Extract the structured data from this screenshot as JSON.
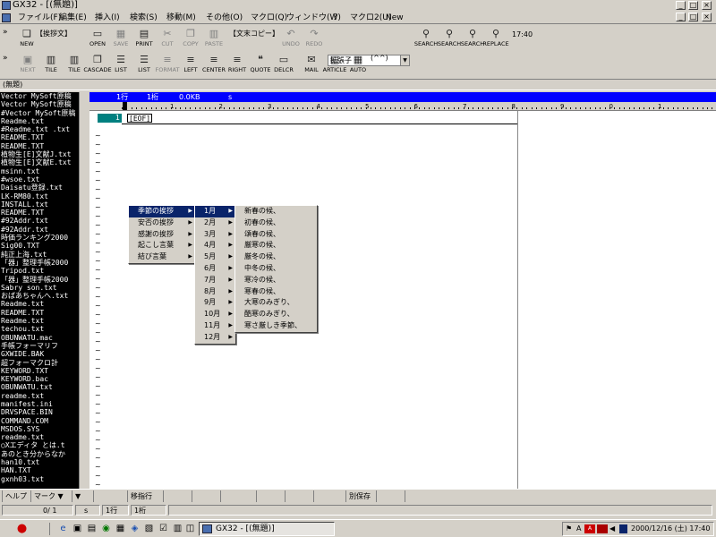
{
  "window": {
    "title": "GX32 - [(無題)]"
  },
  "menu": [
    "ファイル(F)",
    "編集(E)",
    "挿入(I)",
    "検索(S)",
    "移動(M)",
    "その他(O)",
    "マクロ(Q)",
    "ウィンドウ(W)",
    "？",
    "マクロ2(U)",
    "New"
  ],
  "toolbar1": {
    "prefix": "»",
    "tag": "【挨拶文】",
    "tag2": "【文末コピー】",
    "buttons": [
      "NEW",
      "OPEN",
      "SAVE",
      "PRINT",
      "CUT",
      "COPY",
      "PASTE",
      "UNDO",
      "REDO"
    ],
    "disabled": [
      "SAVE",
      "CUT",
      "COPY",
      "PASTE",
      "UNDO",
      "REDO"
    ],
    "type_field": "拡張子",
    "search_buttons": [
      "SEARCH",
      "SEARCH",
      "SEARCH",
      "REPLACE"
    ],
    "clock": "17:40"
  },
  "toolbar2": {
    "prefix": "»",
    "buttons": [
      "NEXT",
      "TILE",
      "TILE",
      "CASCADE",
      "LIST",
      "LIST",
      "FORMAT",
      "LEFT",
      "CENTER",
      "RIGHT",
      "QUOTE",
      "DELCR",
      "MAIL",
      "ARTICLE",
      "AUTO"
    ],
    "disabled": [
      "NEXT",
      "FORMAT"
    ],
    "face": "(^^)"
  },
  "doc_name": "(無題)",
  "file_list": [
    "Vector MySoft原稿",
    "Vector MySoft原稿",
    "#Vector MySoft原稿",
    "Readme.txt",
    "#Readme.txt  .txt",
    "README.TXT",
    "README.TXT",
    "植物生[E]文献J.txt",
    "植物生[E]文献E.txt",
    "msinn.txt",
    "#wsoe.txt",
    "Daisatu登録.txt",
    "LK-RM80.txt",
    "INSTALL.txt",
    "README.TXT",
    "#92Addr.txt",
    "#92Addr.txt",
    "時価ランキング2000",
    "Sig00.TXT",
    "純正上海.txt",
    "「器」整理手帳2000",
    "Tripod.txt",
    "「器」整理手帳2000",
    "Sabry son.txt",
    "おばあちゃんへ.txt",
    "Readme.txt",
    "README.TXT",
    "Readme.txt",
    "techou.txt",
    "OBUNWATU.mac",
    "手帳フォーマリフ",
    "GXWIDE.BAK",
    "超フォーマクロ計",
    "KEYWORD.TXT",
    "KEYWORD.bac",
    "OBUNWATU.txt",
    "readme.txt",
    "manifest.ini",
    "DRVSPACE.BIN",
    "COMMAND.COM",
    "MSDOS.SYS",
    "readme.txt",
    "○Xエディタ とは.t",
    "あのとき分からなか",
    "han10.txt",
    "HAN.TXT",
    "gxnh03.txt"
  ],
  "editor": {
    "status": {
      "line": "1行",
      "col": "1桁",
      "size": "0.0KB",
      "mode": "s"
    },
    "ruler_numbers": [
      "1",
      "2",
      "3",
      "4",
      "5",
      "6",
      "7",
      "8",
      "9",
      "0",
      "1"
    ],
    "line_number": "1",
    "eof": "[EOF]",
    "tilde": "~"
  },
  "popup_main": {
    "items": [
      "季節の挨拶",
      "安否の挨拶",
      "感謝の挨拶",
      "起こし言葉",
      "結び言葉"
    ],
    "selected": 0
  },
  "popup_months": {
    "items": [
      "1月",
      "2月",
      "3月",
      "4月",
      "5月",
      "6月",
      "7月",
      "8月",
      "9月",
      "10月",
      "11月",
      "12月"
    ],
    "selected": 0
  },
  "popup_greetings": {
    "items": [
      "新春の候、",
      "初春の候、",
      "頌春の候、",
      "厳寒の候、",
      "厳冬の候、",
      "中冬の候、",
      "寒冷の候、",
      "寒春の候、",
      "大寒のみぎり、",
      "酷寒のみぎり、",
      "寒さ厳しき季節、"
    ]
  },
  "statusbar1": {
    "items": [
      "ヘルプ",
      "マーク ▼",
      "▼",
      "",
      "移指行",
      "",
      "",
      "",
      "",
      "",
      "",
      "別保存",
      "",
      ""
    ]
  },
  "statusbar2": {
    "pos": "0/  1",
    "mode": "s",
    "line": "1行",
    "col": "1桁"
  },
  "taskbar": {
    "task": "GX32 - [(無題)]",
    "clock": "2000/12/16 (土) 17:40"
  }
}
